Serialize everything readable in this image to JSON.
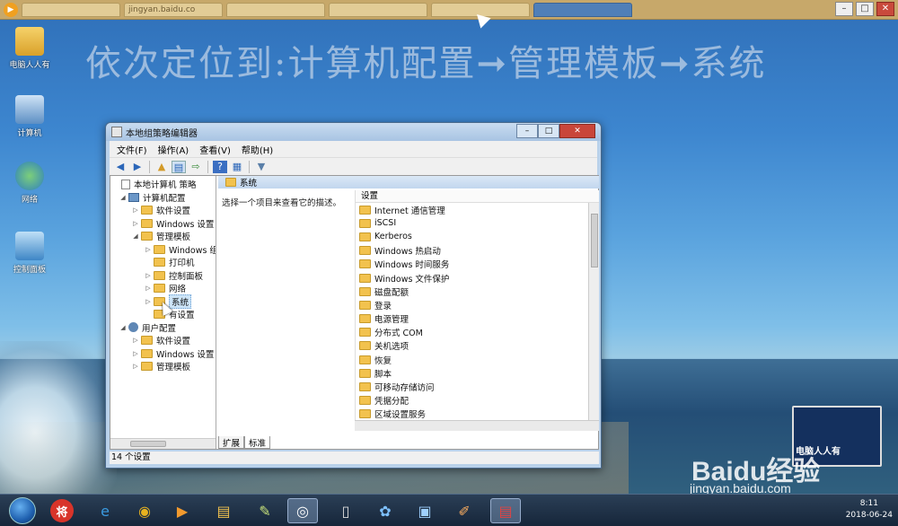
{
  "headline": "依次定位到:计算机配置➞管理模板➞系统",
  "top_tabs": [
    "jingyan.baidu.co",
    "",
    "",
    "",
    "",
    ""
  ],
  "desktop_icons": [
    {
      "label": "电脑人人有",
      "icon": "user-folder-icon"
    },
    {
      "label": "计算机",
      "icon": "computer-icon"
    },
    {
      "label": "网络",
      "icon": "network-icon"
    },
    {
      "label": "控制面板",
      "icon": "control-panel-icon"
    }
  ],
  "window": {
    "title": "本地组策略编辑器",
    "menu": [
      "文件(F)",
      "操作(A)",
      "查看(V)",
      "帮助(H)"
    ],
    "tree": [
      {
        "label": "本地计算机 策略",
        "icon": "doc",
        "indent": 0,
        "toggle": ""
      },
      {
        "label": "计算机配置",
        "icon": "pc",
        "indent": 1,
        "toggle": "◢"
      },
      {
        "label": "软件设置",
        "icon": "folder",
        "indent": 2,
        "toggle": "▷"
      },
      {
        "label": "Windows 设置",
        "icon": "folder",
        "indent": 2,
        "toggle": "▷"
      },
      {
        "label": "管理模板",
        "icon": "folder",
        "indent": 2,
        "toggle": "◢"
      },
      {
        "label": "Windows 组",
        "icon": "folder",
        "indent": 3,
        "toggle": "▷"
      },
      {
        "label": "打印机",
        "icon": "folder",
        "indent": 3,
        "toggle": ""
      },
      {
        "label": "控制面板",
        "icon": "folder",
        "indent": 3,
        "toggle": "▷"
      },
      {
        "label": "网络",
        "icon": "folder",
        "indent": 3,
        "toggle": "▷"
      },
      {
        "label": "系统",
        "icon": "folder",
        "indent": 3,
        "toggle": "▷",
        "selected": true
      },
      {
        "label": "有设置",
        "icon": "folder",
        "indent": 3,
        "toggle": ""
      },
      {
        "label": "用户配置",
        "icon": "user",
        "indent": 1,
        "toggle": "◢"
      },
      {
        "label": "软件设置",
        "icon": "folder",
        "indent": 2,
        "toggle": "▷"
      },
      {
        "label": "Windows 设置",
        "icon": "folder",
        "indent": 2,
        "toggle": "▷"
      },
      {
        "label": "管理模板",
        "icon": "folder",
        "indent": 2,
        "toggle": "▷"
      }
    ],
    "pane_title": "系统",
    "description": "选择一个项目来查看它的描述。",
    "list_header": "设置",
    "items": [
      "Internet 通信管理",
      "iSCSI",
      "Kerberos",
      "Windows 热启动",
      "Windows 时间服务",
      "Windows 文件保护",
      "磁盘配额",
      "登录",
      "电源管理",
      "分布式 COM",
      "关机选项",
      "恢复",
      "脚本",
      "可移动存储访问",
      "凭据分配",
      "区域设置服务"
    ],
    "tabs": [
      "扩展",
      "标准"
    ],
    "status": "14 个设置"
  },
  "brand_text": "电脑人人有",
  "watermark": {
    "logo": "Baidu经验",
    "url": "jingyan.baidu.com"
  },
  "clock": {
    "time": "8:11",
    "date": "2018-06-24"
  },
  "taskbar_icons": [
    "start-orb-icon",
    "jiang-icon",
    "ie-icon",
    "chrome-icon",
    "media-player-icon",
    "explorer-icon",
    "notes-icon",
    "recorder-icon",
    "doc-icon",
    "app-icon",
    "remote-desktop-icon",
    "paint-icon",
    "toolbox-icon"
  ]
}
